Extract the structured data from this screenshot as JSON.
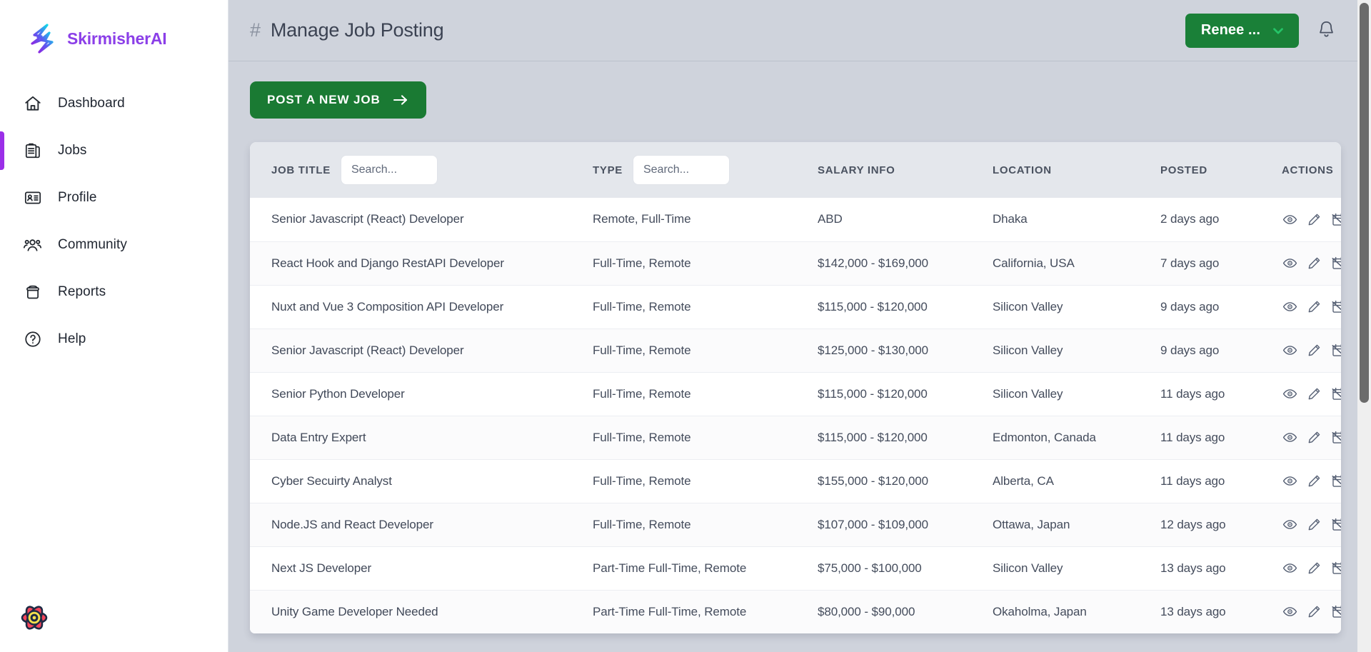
{
  "brand": {
    "name": "SkirmisherAI",
    "logo_icon": "lightning-bolt-icon",
    "accent_color": "#8b3fe8"
  },
  "sidebar": {
    "items": [
      {
        "label": "Dashboard",
        "icon": "home-icon",
        "active": false
      },
      {
        "label": "Jobs",
        "icon": "clipboard-icon",
        "active": true
      },
      {
        "label": "Profile",
        "icon": "id-card-icon",
        "active": false
      },
      {
        "label": "Community",
        "icon": "people-icon",
        "active": false
      },
      {
        "label": "Reports",
        "icon": "archive-icon",
        "active": false
      },
      {
        "label": "Help",
        "icon": "question-circle-icon",
        "active": false
      }
    ],
    "active_indicator_color": "#9b2fe8",
    "footer_logo_icon": "react-atom-flower-icon"
  },
  "header": {
    "hash_symbol": "#",
    "title": "Manage Job Posting",
    "user_menu": {
      "label": "Renee ...",
      "chevron_icon": "chevron-down-icon",
      "color": "#1a8038"
    },
    "notification_icon": "bell-icon"
  },
  "toolbar": {
    "post_job_label": "POST A NEW JOB",
    "post_job_icon": "arrow-right-icon",
    "post_job_color": "#1a7a33"
  },
  "table": {
    "columns": [
      {
        "key": "title",
        "label": "JOB TITLE",
        "has_search": true,
        "search_placeholder": "Search...",
        "search_value": ""
      },
      {
        "key": "type",
        "label": "TYPE",
        "has_search": true,
        "search_placeholder": "Search...",
        "search_value": ""
      },
      {
        "key": "salary",
        "label": "SALARY INFO",
        "has_search": false
      },
      {
        "key": "loc",
        "label": "LOCATION",
        "has_search": false
      },
      {
        "key": "posted",
        "label": "POSTED",
        "has_search": false
      },
      {
        "key": "actions",
        "label": "ACTIONS",
        "has_search": false
      }
    ],
    "action_icons": [
      {
        "name": "eye-icon",
        "title": "View"
      },
      {
        "name": "pencil-icon",
        "title": "Edit"
      },
      {
        "name": "calendar-slash-icon",
        "title": "Unpublish"
      }
    ],
    "rows": [
      {
        "title": "Senior Javascript (React) Developer",
        "type": "Remote, Full-Time",
        "salary": "ABD",
        "loc": "Dhaka",
        "posted": "2 days ago"
      },
      {
        "title": "React Hook and Django RestAPI Developer",
        "type": "Full-Time, Remote",
        "salary": "$142,000 - $169,000",
        "loc": "California, USA",
        "posted": "7 days ago"
      },
      {
        "title": "Nuxt and Vue 3 Composition API Developer",
        "type": "Full-Time, Remote",
        "salary": "$115,000 - $120,000",
        "loc": "Silicon Valley",
        "posted": "9 days ago"
      },
      {
        "title": "Senior Javascript (React) Developer",
        "type": "Full-Time, Remote",
        "salary": "$125,000 - $130,000",
        "loc": "Silicon Valley",
        "posted": "9 days ago"
      },
      {
        "title": "Senior Python Developer",
        "type": "Full-Time, Remote",
        "salary": "$115,000 - $120,000",
        "loc": "Silicon Valley",
        "posted": "11 days ago"
      },
      {
        "title": "Data Entry Expert",
        "type": "Full-Time, Remote",
        "salary": "$115,000 - $120,000",
        "loc": "Edmonton, Canada",
        "posted": "11 days ago"
      },
      {
        "title": "Cyber Secuirty Analyst",
        "type": "Full-Time, Remote",
        "salary": "$155,000 - $120,000",
        "loc": "Alberta, CA",
        "posted": "11 days ago"
      },
      {
        "title": "Node.JS and React Developer",
        "type": "Full-Time, Remote",
        "salary": "$107,000 - $109,000",
        "loc": "Ottawa, Japan",
        "posted": "12 days ago"
      },
      {
        "title": "Next JS Developer",
        "type": "Part-Time Full-Time, Remote",
        "salary": "$75,000 - $100,000",
        "loc": "Silicon Valley",
        "posted": "13 days ago"
      },
      {
        "title": "Unity Game Developer Needed",
        "type": "Part-Time Full-Time, Remote",
        "salary": "$80,000 - $90,000",
        "loc": "Okaholma, Japan",
        "posted": "13 days ago"
      }
    ]
  }
}
